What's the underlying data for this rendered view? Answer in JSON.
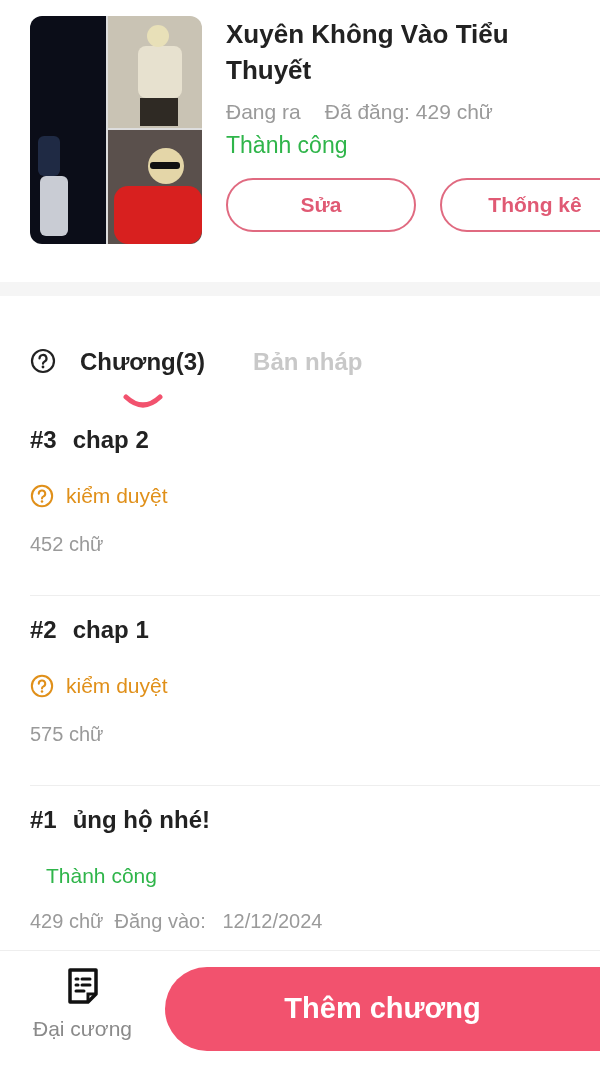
{
  "book": {
    "title": "Xuyên Không Vào Tiểu Thuyết",
    "status": "Đang ra",
    "posted": "Đã đăng: 429 chữ",
    "result": "Thành công",
    "buttons": [
      "Sửa",
      "Thống kê"
    ]
  },
  "tabs": [
    {
      "label": "Chương(3)",
      "selected": true
    },
    {
      "label": "Bản nháp",
      "selected": false
    }
  ],
  "chapters": [
    {
      "number": "#3",
      "title": "chap 2",
      "status": {
        "kind": "review",
        "label": "kiểm duyệt"
      },
      "meta": "452 chữ"
    },
    {
      "number": "#2",
      "title": "chap 1",
      "status": {
        "kind": "review",
        "label": "kiểm duyệt"
      },
      "meta": "575 chữ"
    },
    {
      "number": "#1",
      "title": "ủng hộ nhé!",
      "status": {
        "kind": "success",
        "label": "Thành công"
      },
      "meta": "429 chữ  Đăng vào:   12/12/2024"
    }
  ],
  "bottom_bar": {
    "outline_label": "Đại cương",
    "add_button": "Thêm chương"
  }
}
